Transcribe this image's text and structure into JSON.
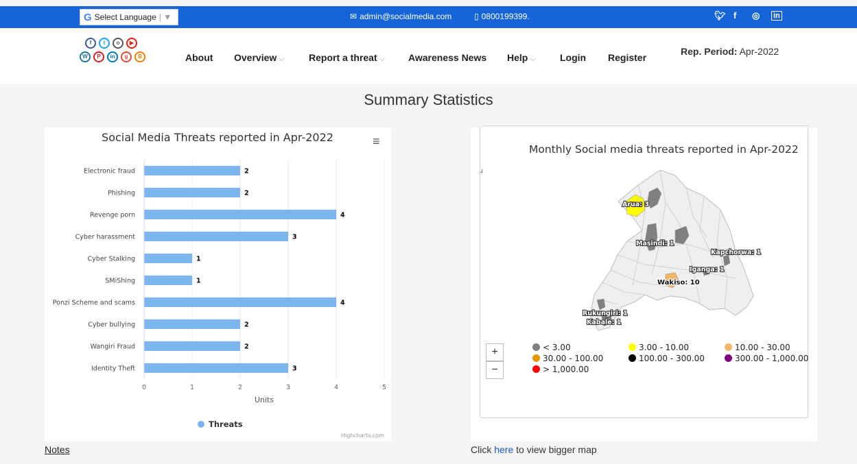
{
  "topbar": {
    "language_label": "Select Language",
    "email": "admin@socialmedia.com",
    "phone": "0800199399.",
    "social_icons": [
      "twitter-icon",
      "facebook-icon",
      "instagram-icon",
      "linkedin-icon"
    ]
  },
  "nav": {
    "items": [
      {
        "label": "About",
        "dropdown": false
      },
      {
        "label": "Overview",
        "dropdown": true
      },
      {
        "label": "Report a threat",
        "dropdown": true
      },
      {
        "label": "Awareness News",
        "dropdown": false
      },
      {
        "label": "Help",
        "dropdown": true
      },
      {
        "label": "Login",
        "dropdown": false
      },
      {
        "label": "Register",
        "dropdown": false
      }
    ],
    "rep_period_label": "Rep. Period:",
    "rep_period_value": "Apr-2022"
  },
  "page_title": "Summary Statistics",
  "chart_data": {
    "type": "bar",
    "orientation": "horizontal",
    "title": "Social Media Threats reported in Apr-2022",
    "categories": [
      "Electronic fraud",
      "Phishing",
      "Revenge porn",
      "Cyber harassment",
      "Cyber Stalking",
      "SMiShing",
      "Ponzi Scheme and scams",
      "Cyber bullying",
      "Wangiri Fraud",
      "Identity Theft"
    ],
    "series": [
      {
        "name": "Threats",
        "values": [
          2,
          2,
          4,
          3,
          1,
          1,
          4,
          2,
          2,
          3
        ]
      }
    ],
    "xlabel": "Units",
    "xlim": [
      0,
      5
    ],
    "ticks": [
      "0",
      "1",
      "2",
      "3",
      "4",
      "5"
    ],
    "grid": true,
    "legend": "bottom-center",
    "bar_color": "#7cb5ec",
    "credit": "Highcharts.com"
  },
  "map": {
    "title": "Monthly Social media threats reported in Apr-2022",
    "corner_mark": "u",
    "labels": [
      "Arua: 3",
      "Masindi: 1",
      "Kapchorwa: 1",
      "Iganga: 1",
      "Wakiso: 10",
      "Rukungiri: 1",
      "Kabale: 1"
    ],
    "zoom_in": "+",
    "zoom_out": "−",
    "legend": [
      {
        "label": "< 3.00",
        "color": "#808080"
      },
      {
        "label": "3.00 - 10.00",
        "color": "#ffff00"
      },
      {
        "label": "10.00 - 30.00",
        "color": "#f4b76a"
      },
      {
        "label": "30.00 - 100.00",
        "color": "#e8950c"
      },
      {
        "label": "100.00 - 300.00",
        "color": "#000000"
      },
      {
        "label": "300.00 - 1,000.00",
        "color": "#800080"
      },
      {
        "label": "> 1,000.00",
        "color": "#ff0000"
      }
    ]
  },
  "footer": {
    "notes": "Notes",
    "bigmap_prefix": "Click ",
    "bigmap_link": "here",
    "bigmap_suffix": " to view bigger map"
  },
  "colors": {
    "topbar": "#1565d8",
    "link": "#1a55c9"
  }
}
